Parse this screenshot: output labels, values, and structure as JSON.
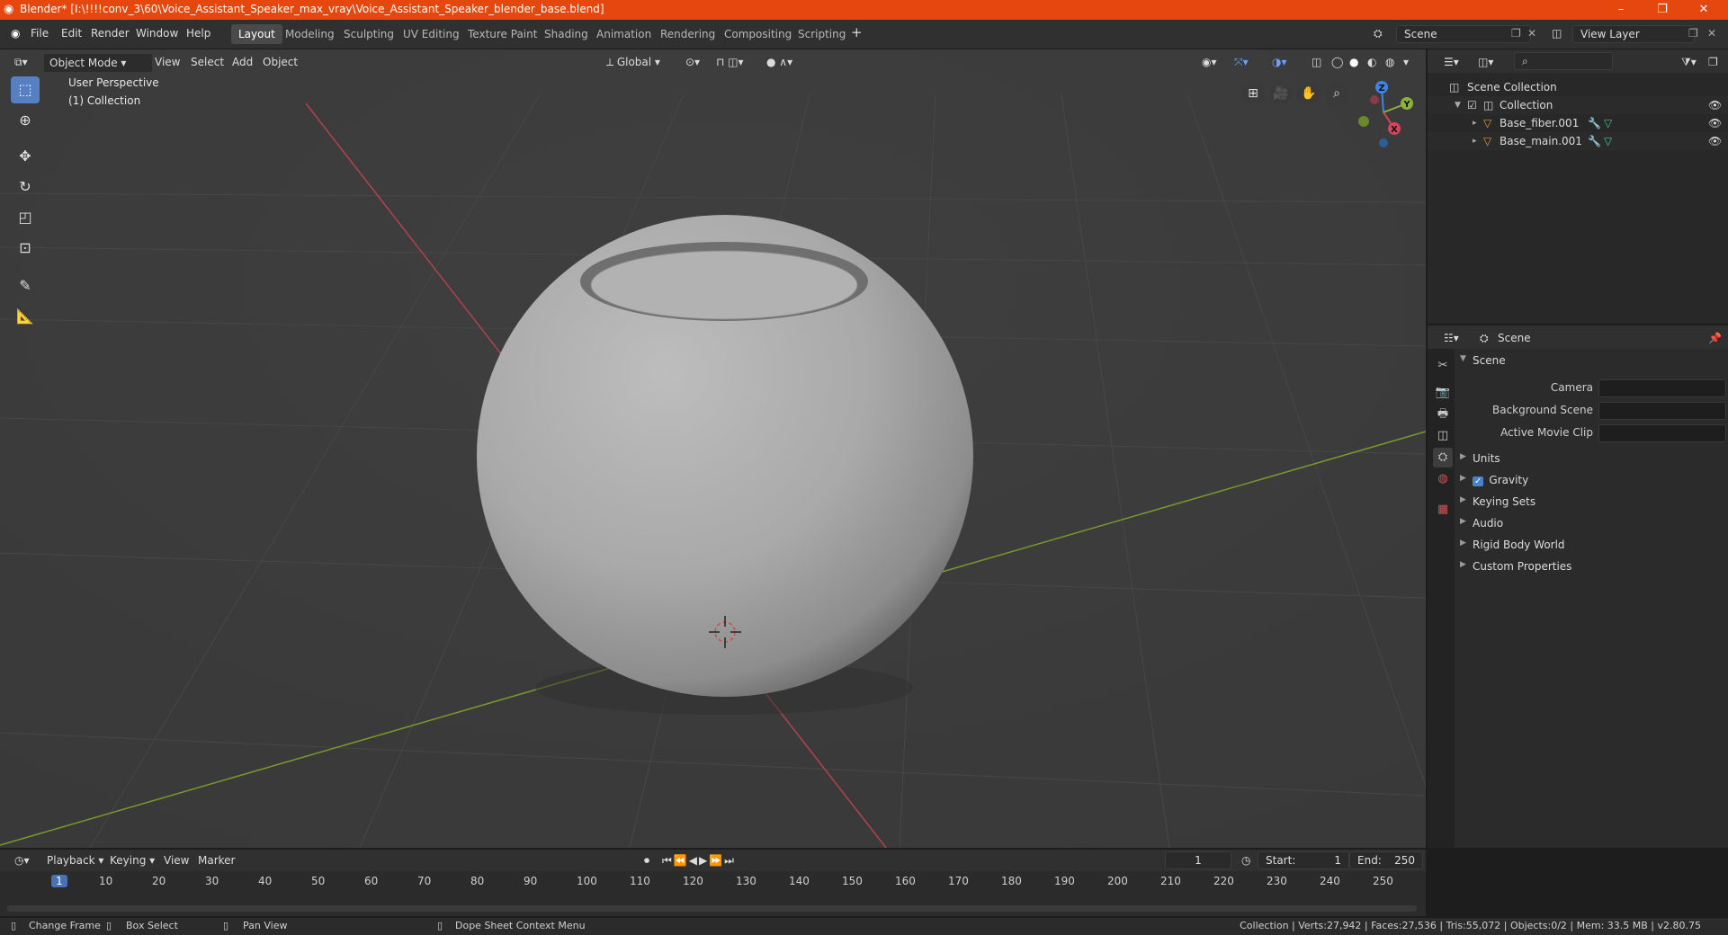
{
  "window": {
    "title": "Blender* [I:\\!!!!conv_3\\60\\Voice_Assistant_Speaker_max_vray\\Voice_Assistant_Speaker_blender_base.blend]",
    "minimize": "–",
    "maximize": "❐",
    "close": "✕"
  },
  "menu": [
    "File",
    "Edit",
    "Render",
    "Window",
    "Help"
  ],
  "workspaces": [
    "Layout",
    "Modeling",
    "Sculpting",
    "UV Editing",
    "Texture Paint",
    "Shading",
    "Animation",
    "Rendering",
    "Compositing",
    "Scripting"
  ],
  "scene_field": "Scene",
  "view_layer_field": "View Layer",
  "viewport": {
    "mode": "Object Mode",
    "menus": [
      "View",
      "Select",
      "Add",
      "Object"
    ],
    "transform": "Global",
    "overlay_title": "User Perspective",
    "overlay_collection": "(1) Collection",
    "gizmo": {
      "x": "X",
      "y": "Y",
      "z": "Z"
    },
    "colors": {
      "x_axis": "#d3455a",
      "y_axis": "#8bb339",
      "z_axis": "#3f84e5",
      "active_tool": "#5680c2"
    }
  },
  "outliner": {
    "search_placeholder": "",
    "root": "Scene Collection",
    "collection": "Collection",
    "objects": [
      "Base_fiber.001",
      "Base_main.001"
    ]
  },
  "properties": {
    "header": "Scene",
    "panel": "Scene",
    "fields": [
      {
        "label": "Camera",
        "value": ""
      },
      {
        "label": "Background Scene",
        "value": ""
      },
      {
        "label": "Active Movie Clip",
        "value": ""
      }
    ],
    "sections": [
      "Units",
      "Gravity",
      "Keying Sets",
      "Audio",
      "Rigid Body World",
      "Custom Properties"
    ],
    "gravity_checked": true
  },
  "timeline": {
    "menus": [
      "Playback",
      "Keying",
      "View",
      "Marker"
    ],
    "current_frame": "1",
    "start_label": "Start:",
    "start": "1",
    "end_label": "End:",
    "end": "250",
    "ticks": [
      "1",
      "10",
      "20",
      "30",
      "40",
      "50",
      "60",
      "70",
      "80",
      "90",
      "100",
      "110",
      "120",
      "130",
      "140",
      "150",
      "160",
      "170",
      "180",
      "190",
      "200",
      "210",
      "220",
      "230",
      "240",
      "250"
    ]
  },
  "statusbar": {
    "change_frame": "Change Frame",
    "box_select": "Box Select",
    "pan_view": "Pan View",
    "context_menu": "Dope Sheet Context Menu",
    "stats": "Collection | Verts:27,942 | Faces:27,536 | Tris:55,072 | Objects:0/2 | Mem: 33.5 MB | v2.80.75"
  }
}
